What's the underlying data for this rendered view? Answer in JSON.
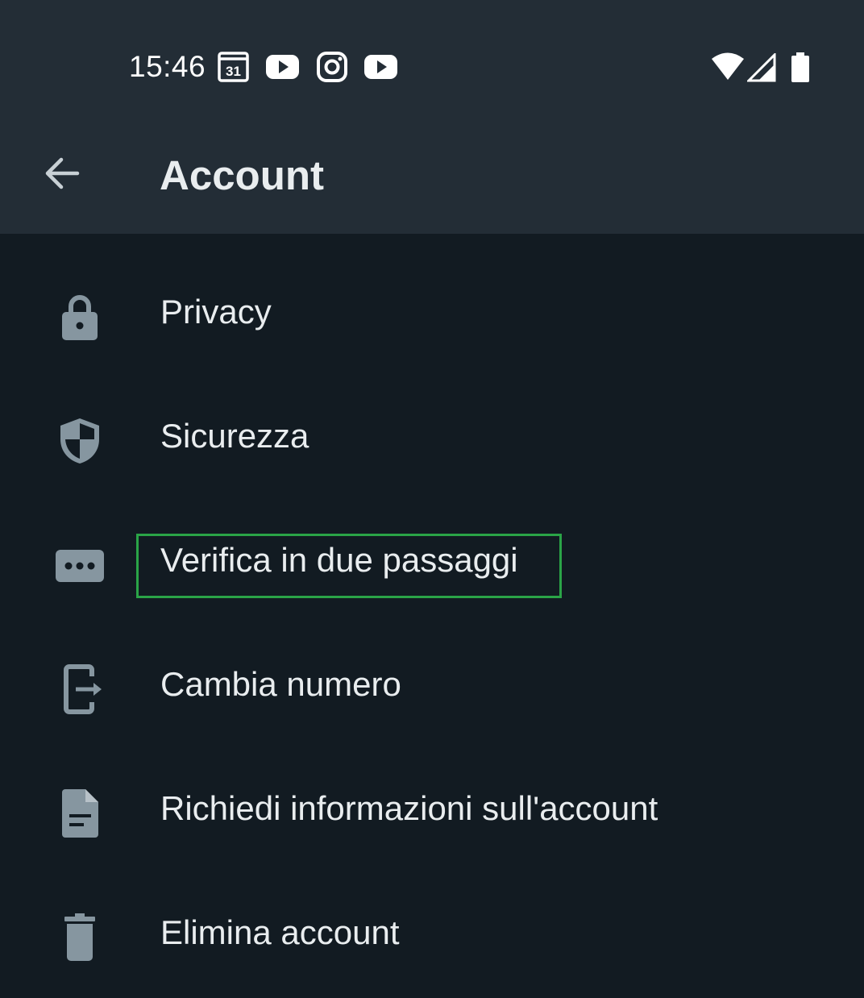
{
  "status_bar": {
    "time": "15:46",
    "calendar_day": "31",
    "notification_icons": [
      "calendar-icon",
      "youtube-icon",
      "instagram-icon",
      "youtube-icon"
    ],
    "system_icons": [
      "wifi-icon",
      "signal-icon",
      "battery-icon"
    ]
  },
  "appbar": {
    "back_icon": "arrow-left-icon",
    "title": "Account"
  },
  "menu": {
    "items": [
      {
        "label": "Privacy",
        "icon": "lock-icon"
      },
      {
        "label": "Sicurezza",
        "icon": "shield-icon"
      },
      {
        "label": "Verifica in due passaggi",
        "icon": "dots-pin-icon"
      },
      {
        "label": "Cambia numero",
        "icon": "phone-transfer-icon"
      },
      {
        "label": "Richiedi informazioni sull'account",
        "icon": "document-icon"
      },
      {
        "label": "Elimina account",
        "icon": "trash-icon"
      }
    ]
  },
  "colors": {
    "header_bg": "#232d36",
    "body_bg": "#121b22",
    "text": "#e9edef",
    "icon": "#8696a0",
    "highlight": "#2aa447"
  }
}
